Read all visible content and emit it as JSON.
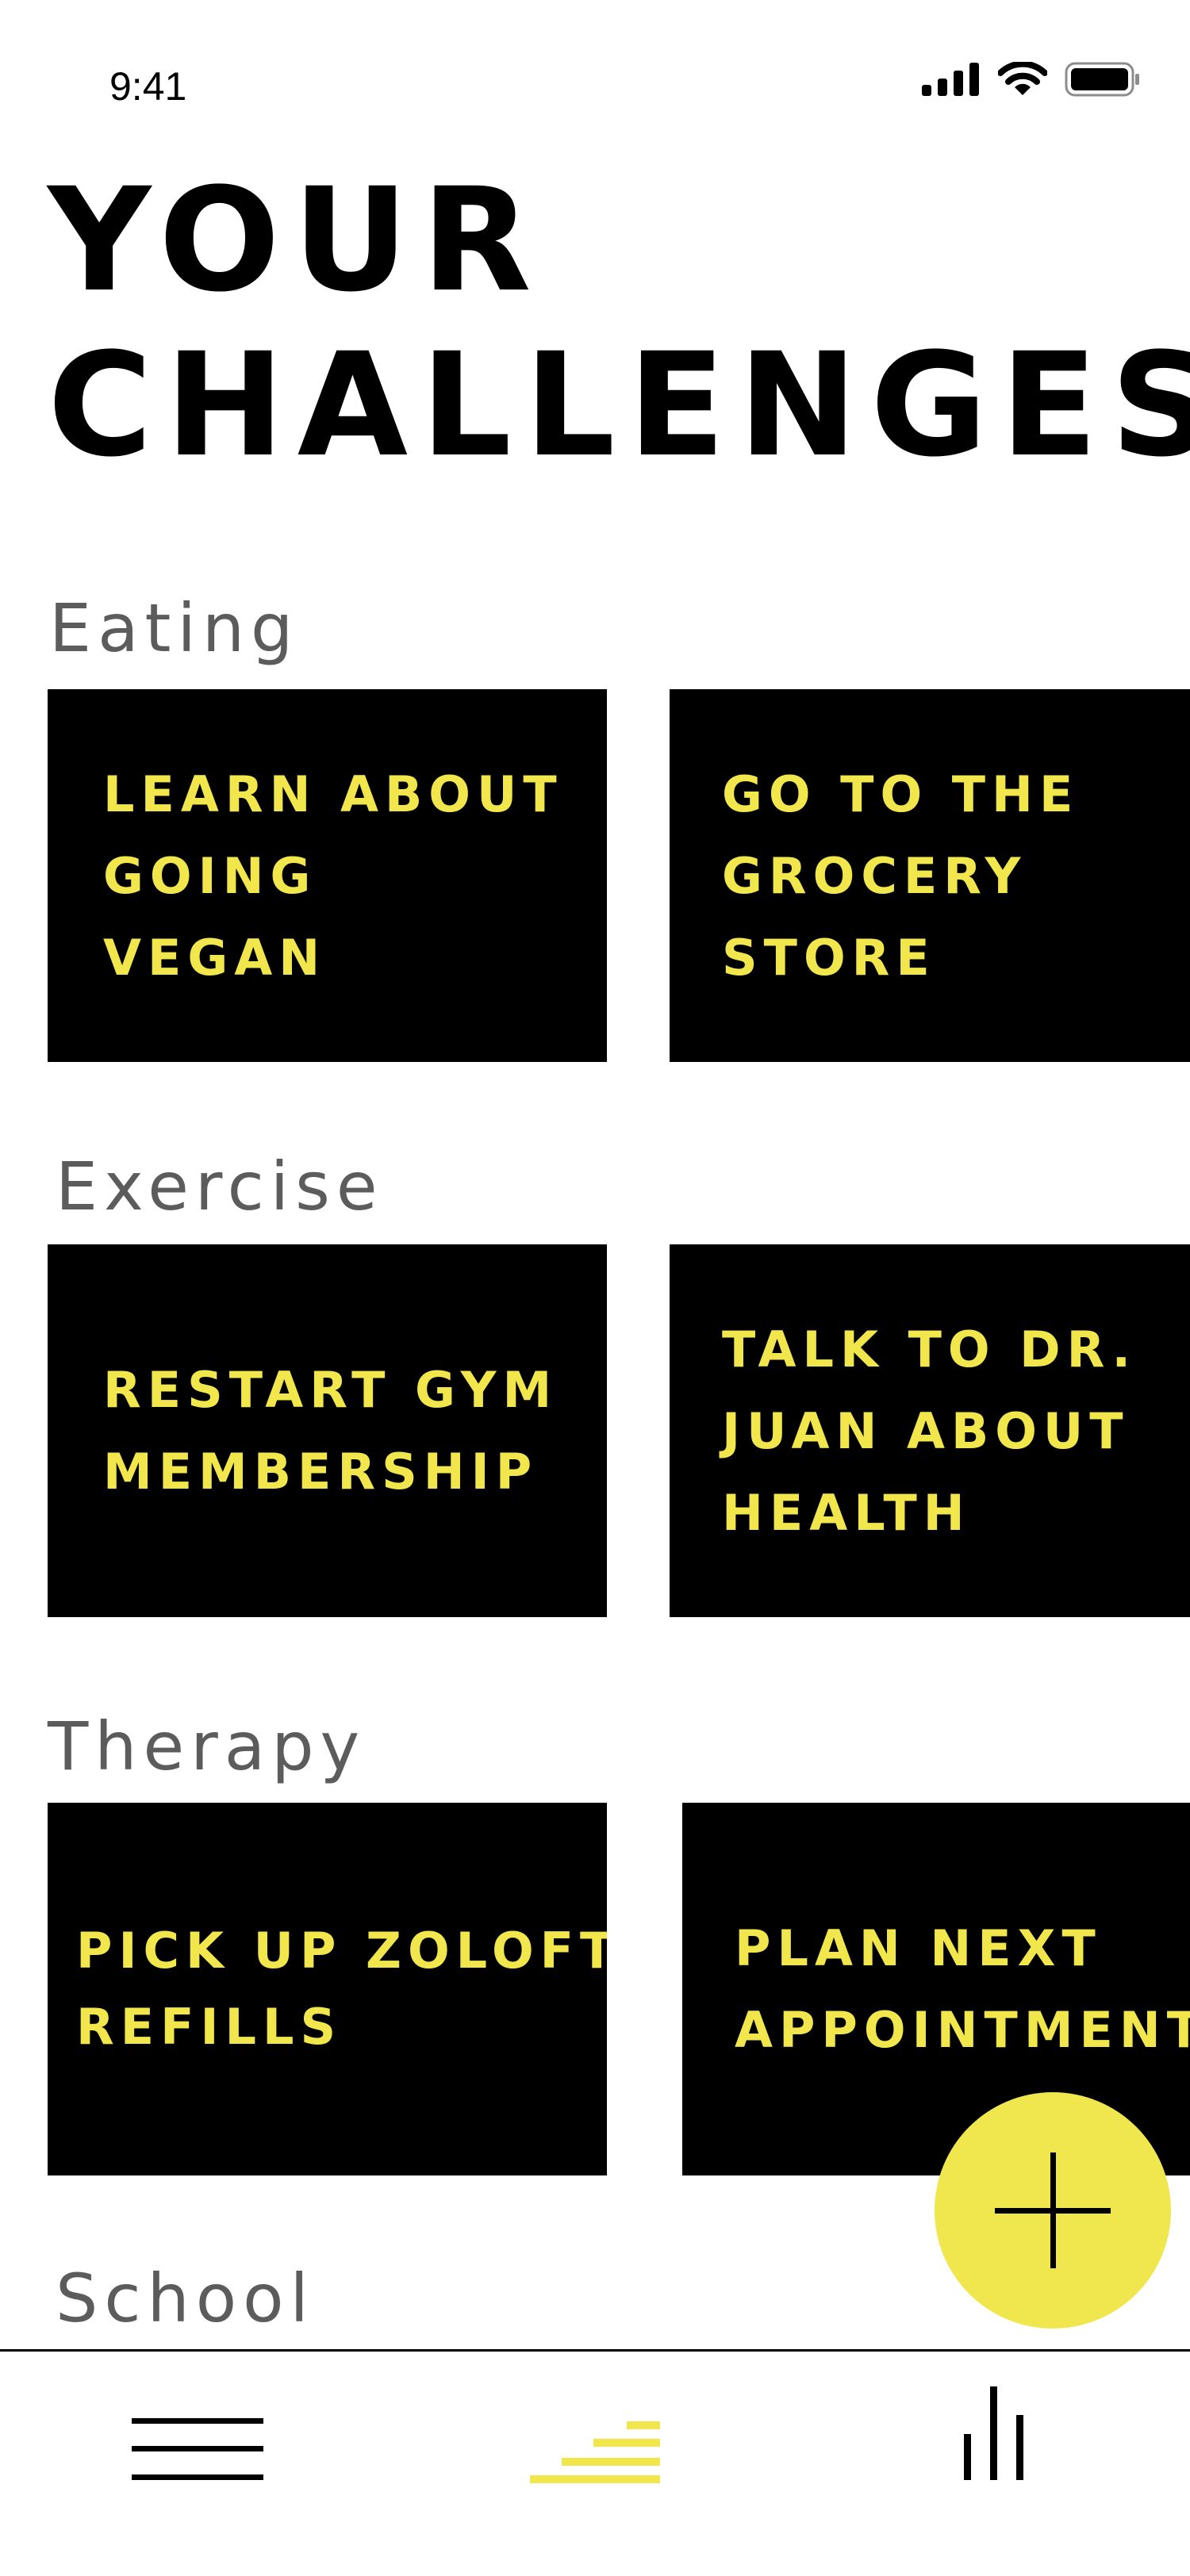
{
  "status_bar": {
    "time": "9:41"
  },
  "header": {
    "title_line1": "YOUR",
    "title_line2": "CHALLENGES"
  },
  "sections": [
    {
      "label": "Eating",
      "cards": [
        {
          "text": "LEARN ABOUT\nGOING\nVEGAN"
        },
        {
          "text": "GO TO THE\nGROCERY\nSTORE"
        }
      ]
    },
    {
      "label": "Exercise",
      "cards": [
        {
          "text": "RESTART GYM\nMEMBERSHIP"
        },
        {
          "text": "TALK TO DR.\nJUAN ABOUT\nHEALTH"
        }
      ]
    },
    {
      "label": "Therapy",
      "cards": [
        {
          "text": "PICK UP ZOLOFT\nREFILLS"
        },
        {
          "text": "PLAN NEXT\nAPPOINTMENT"
        }
      ]
    },
    {
      "label": "School",
      "cards": []
    }
  ],
  "fab": {
    "icon": "plus-icon"
  },
  "tab_bar": {
    "items": [
      {
        "icon": "menu-icon"
      },
      {
        "icon": "challenges-icon",
        "active": true
      },
      {
        "icon": "stats-icon"
      }
    ]
  },
  "colors": {
    "accent": "#F2E64D",
    "card_bg": "#000000",
    "label": "#5C5C5C"
  }
}
